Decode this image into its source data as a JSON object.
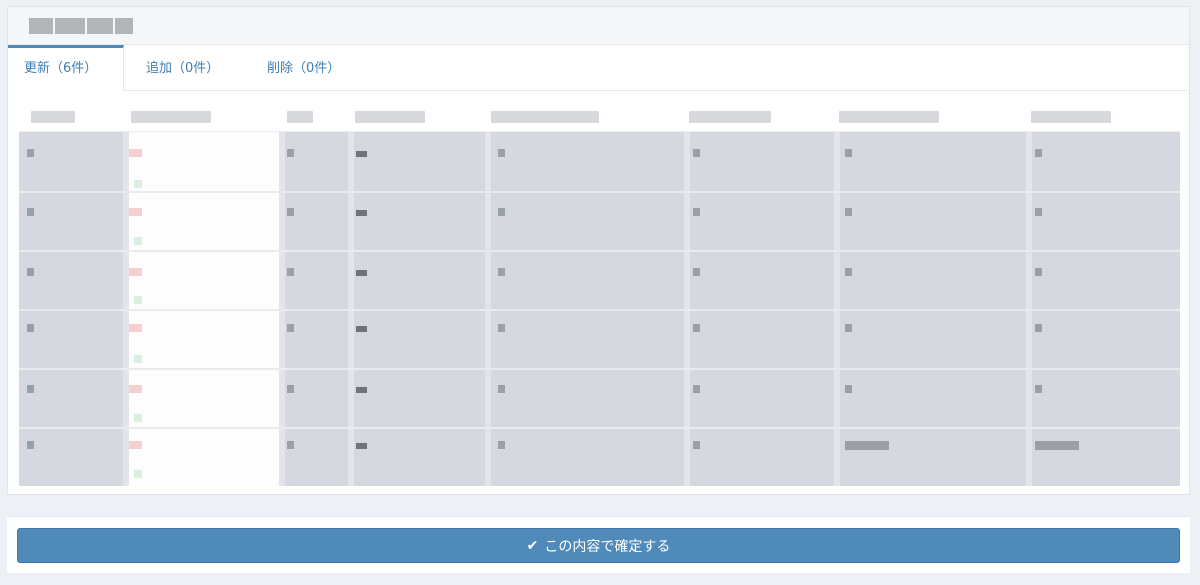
{
  "tabs": [
    {
      "label": "更新（6件）",
      "active": true
    },
    {
      "label": "追加（0件）",
      "active": false
    },
    {
      "label": "削除（0件）",
      "active": false
    }
  ],
  "confirm": {
    "label": "この内容で確定する",
    "icon": "check-icon"
  },
  "colors": {
    "accent": "#4f8ab9",
    "tab_text": "#3f7fb5",
    "row_gray": "#d5d8df",
    "page_bg": "#edf1f6"
  },
  "table": {
    "row_count": 6,
    "column_count": 8
  }
}
